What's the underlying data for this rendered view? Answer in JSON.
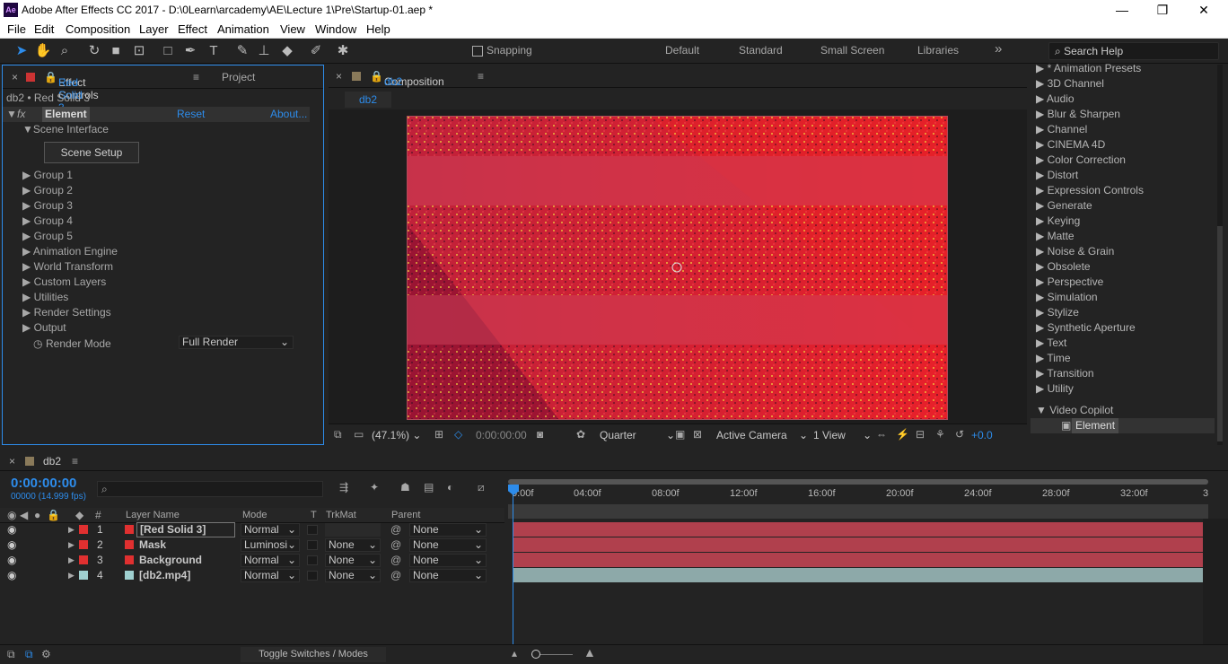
{
  "titlebar": {
    "title": "Adobe After Effects CC 2017 - D:\\0Learn\\arcademy\\AE\\Lecture 1\\Pre\\Startup-01.aep *",
    "logo": "Ae",
    "minimize": "—",
    "restore": "❐",
    "close": "✕"
  },
  "menu": [
    "File",
    "Edit",
    "Composition",
    "Layer",
    "Effect",
    "Animation",
    "View",
    "Window",
    "Help"
  ],
  "toolbar": {
    "snapping": "Snapping",
    "workspaces": [
      "Default",
      "Standard",
      "Small Screen",
      "Libraries"
    ],
    "more": "»",
    "search_placeholder": "Search Help"
  },
  "effect_controls": {
    "tab_prefix": "Effect Controls",
    "tab_layer": "Red Solid 3",
    "tab_project": "Project",
    "breadcrumb": "db2 • Red Solid 3",
    "effect": {
      "fx": "fx",
      "name": "Element",
      "reset": "Reset",
      "about": "About..."
    },
    "scene_interface": "Scene Interface",
    "scene_setup": "Scene Setup",
    "groups": [
      "Group 1",
      "Group 2",
      "Group 3",
      "Group 4",
      "Group 5",
      "Animation Engine",
      "World Transform",
      "Custom Layers",
      "Utilities",
      "Render Settings",
      "Output"
    ],
    "render_mode_label": "Render Mode",
    "render_mode_value": "Full Render"
  },
  "composition": {
    "tab_prefix": "Composition",
    "tab_name": "db2",
    "subtab": "db2",
    "footer": {
      "zoom": "(47.1%)",
      "timecode": "0:00:00:00",
      "resolution": "Quarter",
      "camera": "Active Camera",
      "views": "1 View",
      "exposure": "+0.0"
    }
  },
  "effects_list": {
    "items": [
      "* Animation Presets",
      "3D Channel",
      "Audio",
      "Blur & Sharpen",
      "Channel",
      "CINEMA 4D",
      "Color Correction",
      "Distort",
      "Expression Controls",
      "Generate",
      "Keying",
      "Matte",
      "Noise & Grain",
      "Obsolete",
      "Perspective",
      "Simulation",
      "Stylize",
      "Synthetic Aperture",
      "Text",
      "Time",
      "Transition",
      "Utility"
    ],
    "expanded": "Video Copilot",
    "sub_item": "Element"
  },
  "timeline": {
    "tab": "db2",
    "timecode": "0:00:00:00",
    "frames": "00000 (14.999 fps)",
    "search_placeholder": "",
    "headers": {
      "num": "#",
      "name": "Layer Name",
      "mode": "Mode",
      "t": "T",
      "trkmat": "TrkMat",
      "parent": "Parent"
    },
    "ruler": [
      "0:00f",
      "04:00f",
      "08:00f",
      "12:00f",
      "16:00f",
      "20:00f",
      "24:00f",
      "28:00f",
      "32:00f",
      "3"
    ],
    "layers": [
      {
        "num": "1",
        "name": "[Red Solid 3]",
        "mode": "Normal",
        "trkmat": "",
        "parent": "None",
        "color": "#e03030"
      },
      {
        "num": "2",
        "name": "Mask",
        "mode": "Luminosi",
        "trkmat": "None",
        "parent": "None",
        "color": "#e03030"
      },
      {
        "num": "3",
        "name": "Background",
        "mode": "Normal",
        "trkmat": "None",
        "parent": "None",
        "color": "#e03030"
      },
      {
        "num": "4",
        "name": "[db2.mp4]",
        "mode": "Normal",
        "trkmat": "None",
        "parent": "None",
        "color": "#9fd0d0"
      }
    ],
    "toggle": "Toggle Switches / Modes"
  },
  "colors": {
    "accent": "#2d8ceb",
    "layer_bar_red": "#b0404d",
    "layer_bar_teal": "#8da9a9"
  }
}
